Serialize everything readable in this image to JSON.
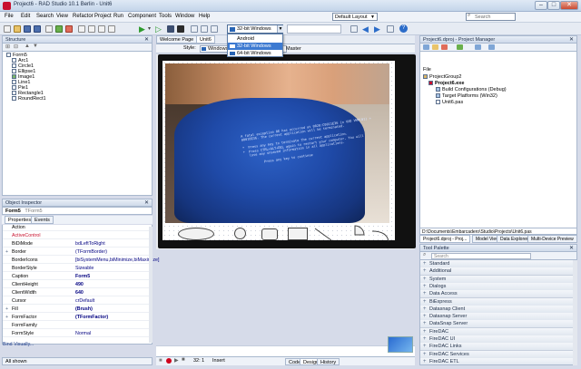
{
  "window": {
    "title": "Project6 - RAD Studio 10.1 Berlin - Unit6",
    "min": "–",
    "max": "□",
    "close": "✕"
  },
  "menu": [
    "File",
    "Edit",
    "Search",
    "View",
    "Refactor",
    "Project",
    "Run",
    "Component",
    "Tools",
    "Window",
    "Help"
  ],
  "layout_select": "Default Layout",
  "search": {
    "placeholder": "Search"
  },
  "platform": {
    "selected": "32-bit Windows",
    "options": [
      "Android",
      "32-bit Windows",
      "64-bit Windows"
    ],
    "highlighted_index": 1
  },
  "structure": {
    "title": "Structure",
    "items": [
      "Form5",
      "Arc1",
      "Circle1",
      "Ellipse1",
      "Image1",
      "Line1",
      "Pie1",
      "Rectangle1",
      "RoundRect1"
    ]
  },
  "designer": {
    "tabs": [
      "Welcome Page",
      "Unit6"
    ],
    "style_label": "Style:",
    "style_value": "Windows",
    "view_label": "Master"
  },
  "photo_text": "A fatal exception 0E has occurred at 0028:C0011E36 in VXD VMM(01) +\n00010E36. The current application will be terminated.\n\n*  Press any key to terminate the current application.\n*  Press CTRL+ALT+DEL again to restart your computer. You will\n   lose any unsaved information in all applications.\n\n          Press any key to continue",
  "object_inspector": {
    "title": "Object Inspector",
    "selected": "Form5",
    "selected_type": "TForm5",
    "tabs": [
      "Properties",
      "Events"
    ],
    "rows": [
      {
        "k": "Action",
        "v": ""
      },
      {
        "k": "ActiveControl",
        "v": ""
      },
      {
        "k": "BiDiMode",
        "v": "bdLeftToRight"
      },
      {
        "k": "Border",
        "v": "(TFormBorder)"
      },
      {
        "k": "BorderIcons",
        "v": "[biSystemMenu,biMinimize,biMaximize]"
      },
      {
        "k": "BorderStyle",
        "v": "Sizeable"
      },
      {
        "k": "Caption",
        "v": "Form5"
      },
      {
        "k": "ClientHeight",
        "v": "490"
      },
      {
        "k": "ClientWidth",
        "v": "640"
      },
      {
        "k": "Cursor",
        "v": "crDefault"
      },
      {
        "k": "Fill",
        "v": "(Brush)"
      },
      {
        "k": "FormFactor",
        "v": "(TFormFactor)"
      },
      {
        "k": "FormFamily",
        "v": ""
      },
      {
        "k": "FormStyle",
        "v": "Normal"
      }
    ],
    "bind_visually": "Bind Visually...",
    "status": "All shown"
  },
  "project_manager": {
    "title": "Project6.dproj - Project Manager",
    "file_label": "File",
    "tree": [
      "ProjectGroup2",
      "Project6.exe",
      "Build Configurations (Debug)",
      "Target Platforms (Win32)",
      "Unit6.pas"
    ],
    "path": "D:\\Documents\\Embarcadero\\Studio\\Projects\\Unit6.pas",
    "tabs": [
      "Project6.dproj - Proj...",
      "Model View",
      "Data Explorer",
      "Multi-Device Preview"
    ]
  },
  "tool_palette": {
    "title": "Tool Palette",
    "search_placeholder": "Search",
    "categories": [
      "Standard",
      "Additional",
      "System",
      "Dialogs",
      "Data Access",
      "BiExpress",
      "Datasnap Client",
      "Datasnap Server",
      "DataSnap Server",
      "FireDAC",
      "FireDAC UI",
      "FireDAC Links",
      "FireDAC Services",
      "FireDAC ETL"
    ]
  },
  "editor_status": {
    "position": "32: 1",
    "mode": "Insert",
    "tabs": [
      "Code",
      "Design",
      "History"
    ]
  },
  "colors": {
    "accent": "#3d7ad1",
    "shirt": "#1f4aa8",
    "record": "#d0021b"
  }
}
